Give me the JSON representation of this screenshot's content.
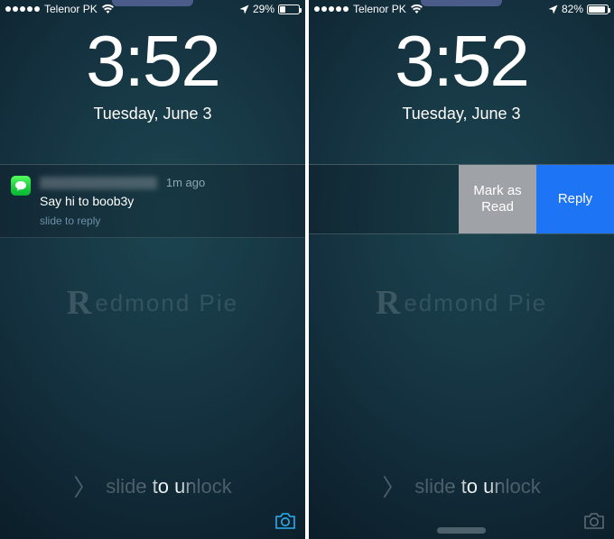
{
  "left": {
    "status": {
      "carrier": "Telenor PK",
      "battery_pct": "29%",
      "battery_fill": 29
    },
    "clock": {
      "time": "3:52",
      "date": "Tuesday, June 3"
    },
    "notification": {
      "timestamp": "1m ago",
      "body": "Say hi to boob3y",
      "hint": "slide to reply",
      "icon_name": "messages-icon"
    },
    "watermark": {
      "initial": "R",
      "rest": "edmond Pie"
    },
    "unlock": "slide to unlock"
  },
  "right": {
    "status": {
      "carrier": "Telenor PK",
      "battery_pct": "82%",
      "battery_fill": 82
    },
    "clock": {
      "time": "3:52",
      "date": "Tuesday, June 3"
    },
    "actions": {
      "mark_label": "Mark as Read",
      "reply_label": "Reply"
    },
    "watermark": {
      "initial": "R",
      "rest": "edmond Pie"
    },
    "unlock": "slide to unlock"
  }
}
